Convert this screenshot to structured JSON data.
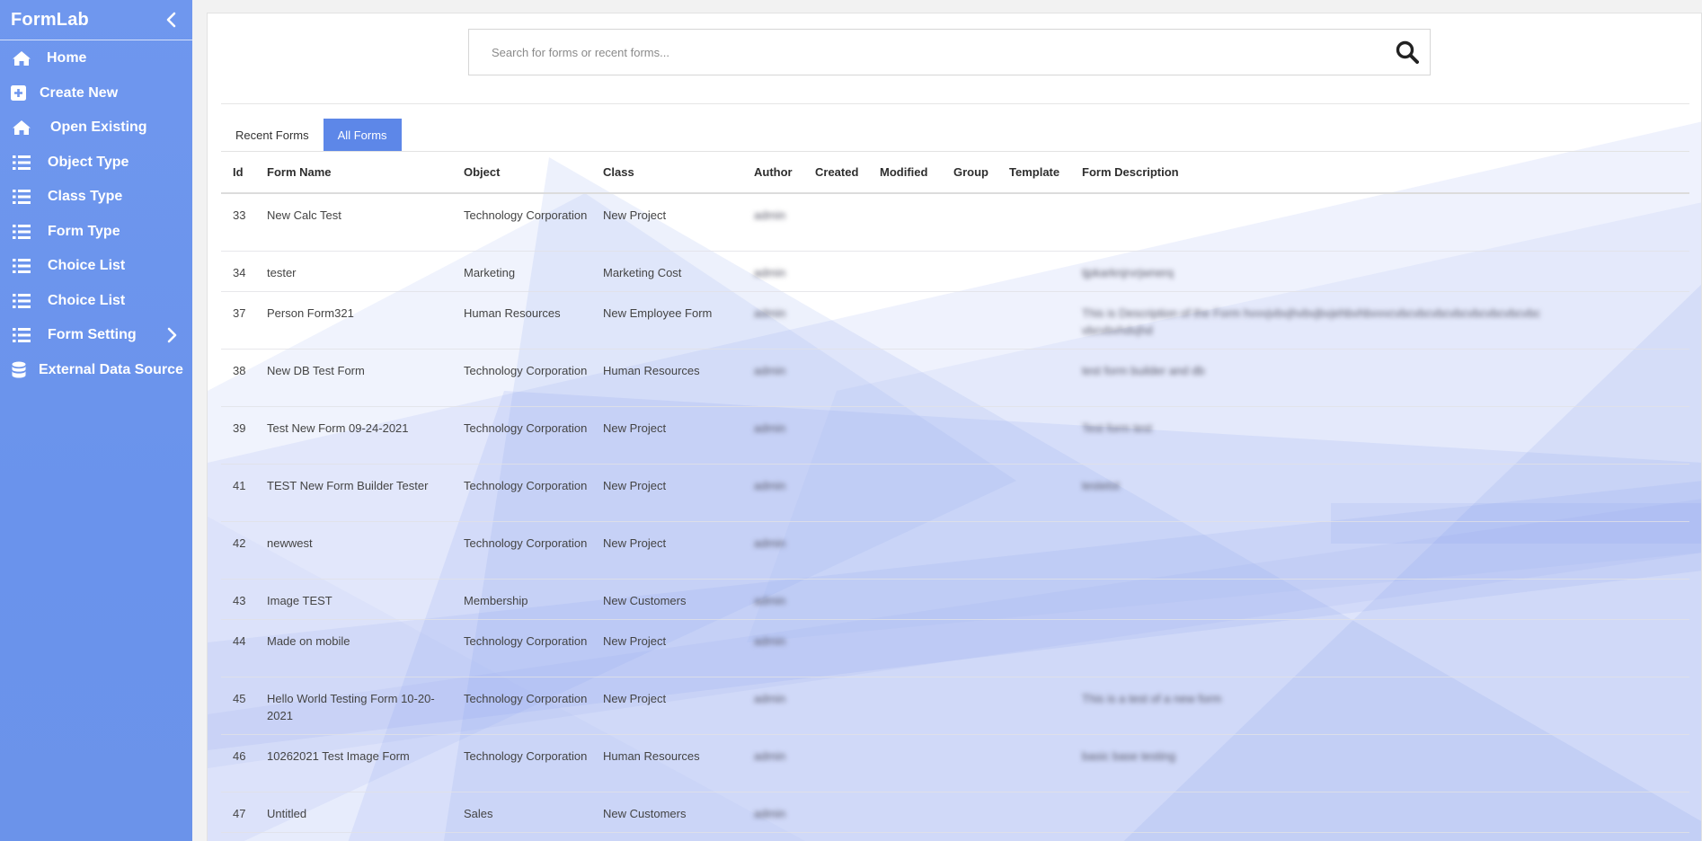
{
  "sidebar": {
    "brand": "FormLab",
    "items": [
      {
        "label": "Home",
        "icon": "home-icon"
      },
      {
        "label": "Create New",
        "icon": "plus-square-icon"
      },
      {
        "label": "Open Existing",
        "icon": "home-icon"
      },
      {
        "label": "Object Type",
        "icon": "list-icon"
      },
      {
        "label": "Class Type",
        "icon": "list-icon"
      },
      {
        "label": "Form Type",
        "icon": "list-icon"
      },
      {
        "label": "Choice List",
        "icon": "list-icon"
      },
      {
        "label": "Choice List",
        "icon": "list-icon"
      },
      {
        "label": "Form Setting",
        "icon": "list-icon"
      },
      {
        "label": "External Data Source",
        "icon": "database-icon"
      }
    ]
  },
  "search": {
    "placeholder": "Search for forms or recent forms..."
  },
  "tabs": [
    {
      "label": "Recent Forms",
      "active": false
    },
    {
      "label": "All Forms",
      "active": true
    }
  ],
  "table": {
    "headers": [
      "Id",
      "Form Name",
      "Object",
      "Class",
      "Author",
      "Created",
      "Modified",
      "Group",
      "Template",
      "Form Description"
    ],
    "rows": [
      {
        "id": "33",
        "name": "New Calc Test",
        "object": "Technology Corporation",
        "class": "New Project",
        "author": "admin",
        "description": ""
      },
      {
        "id": "34",
        "name": "tester",
        "object": "Marketing",
        "class": "Marketing Cost",
        "author": "admin",
        "description": "tjpkarknjrvrjwnerq"
      },
      {
        "id": "37",
        "name": "Person Form321",
        "object": "Human Resources",
        "class": "New Employee Form",
        "author": "admin",
        "description": "This is Description of the Form hvvvjvbvjhvbvjbvjehbvhbvvvcvbcvbcvbcvbcvbcvbcvbcvbcvbcvbvhdvjhd"
      },
      {
        "id": "38",
        "name": "New DB Test Form",
        "object": "Technology Corporation",
        "class": "Human Resources",
        "author": "admin",
        "description": "test form builder and db"
      },
      {
        "id": "39",
        "name": "Test New Form 09-24-2021",
        "object": "Technology Corporation",
        "class": "New Project",
        "author": "admin",
        "description": "Test form test"
      },
      {
        "id": "41",
        "name": "TEST New Form Builder Tester",
        "object": "Technology Corporation",
        "class": "New Project",
        "author": "admin",
        "description": "testetst"
      },
      {
        "id": "42",
        "name": "newwest",
        "object": "Technology Corporation",
        "class": "New Project",
        "author": "admin",
        "description": ""
      },
      {
        "id": "43",
        "name": "Image TEST",
        "object": "Membership",
        "class": "New Customers",
        "author": "admin",
        "description": ""
      },
      {
        "id": "44",
        "name": "Made on mobile",
        "object": "Technology Corporation",
        "class": "New Project",
        "author": "admin",
        "description": ""
      },
      {
        "id": "45",
        "name": "Hello World Testing Form 10-20-2021",
        "object": "Technology Corporation",
        "class": "New Project",
        "author": "admin",
        "description": "This is a test of a new form"
      },
      {
        "id": "46",
        "name": "10262021 Test Image Form",
        "object": "Technology Corporation",
        "class": "Human Resources",
        "author": "admin",
        "description": "basic base testing"
      },
      {
        "id": "47",
        "name": "Untitled",
        "object": "Sales",
        "class": "New Customers",
        "author": "admin",
        "description": ""
      }
    ]
  },
  "colors": {
    "sidebar": "#6b94ec",
    "accent": "#5d87e8",
    "decor": "#7e97ee"
  }
}
